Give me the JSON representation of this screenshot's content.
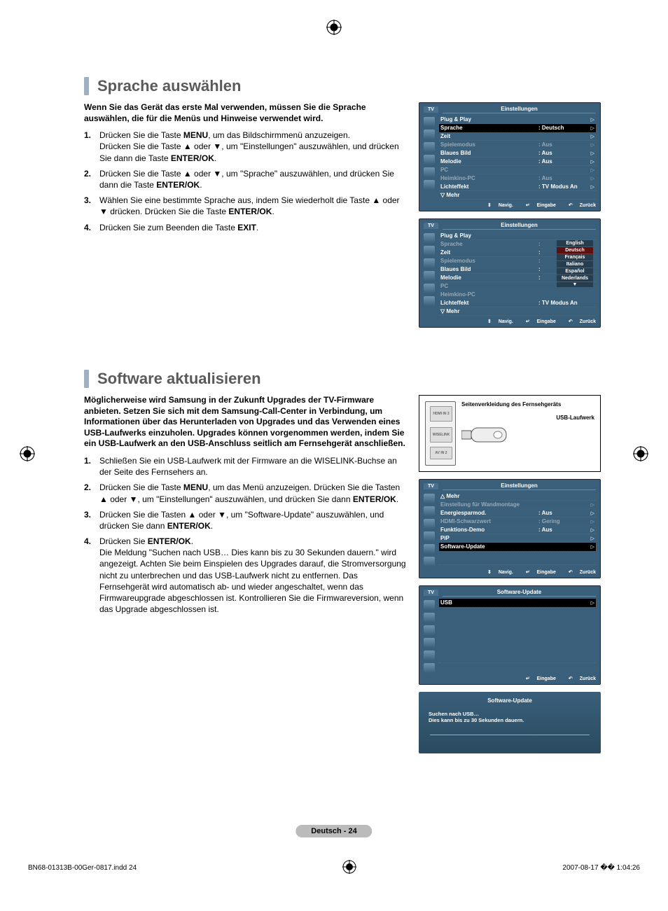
{
  "reg_glyph": "⊕",
  "section1": {
    "title": "Sprache auswählen",
    "intro": "Wenn Sie das Gerät das erste Mal verwenden, müssen Sie die Sprache auswählen, die für die Menüs und Hinweise verwendet wird.",
    "steps": [
      "Drücken Sie die Taste MENU, um das Bildschirmmenü anzuzeigen. Drücken Sie die Taste ▲ oder ▼, um \"Einstellungen\" auszuwählen, und drücken Sie dann die Taste ENTER/OK.",
      "Drücken Sie die Taste ▲ oder ▼, um \"Sprache\" auszuwählen, und drücken Sie dann die Taste ENTER/OK.",
      "Wählen Sie eine bestimmte Sprache aus, indem Sie wiederholt die Taste ▲ oder ▼ drücken. Drücken Sie die Taste ENTER/OK.",
      "Drücken Sie zum Beenden die Taste EXIT."
    ],
    "step1_a": "Drücken Sie die Taste ",
    "step1_menu": "MENU",
    "step1_b": ", um das Bildschirmmenü anzuzeigen.",
    "step1_c": "Drücken Sie die Taste ▲ oder ▼, um \"Einstellungen\" auszuwählen, und drücken Sie dann die Taste ",
    "step1_enter": "ENTER/OK",
    "step2_a": "Drücken Sie die Taste ▲ oder ▼, um \"Sprache\" auszuwählen, und drücken Sie dann die Taste ",
    "step3_a": "Wählen Sie eine bestimmte Sprache aus, indem Sie wiederholt die Taste ▲ oder ▼ drücken. Drücken Sie die Taste ",
    "step3_enter": "ENTER/OK",
    "step4_a": "Drücken Sie zum Beenden die Taste ",
    "step4_exit": "EXIT"
  },
  "osd1": {
    "tv": "TV",
    "title": "Einstellungen",
    "rows": {
      "plugplay": "Plug & Play",
      "sprache": "Sprache",
      "sprache_val": ": Deutsch",
      "zeit": "Zeit",
      "spiel": "Spielemodus",
      "spiel_val": ": Aus",
      "blau": "Blaues Bild",
      "blau_val": ": Aus",
      "melodie": "Melodie",
      "melodie_val": ": Aus",
      "pc": "PC",
      "heimkino": "Heimkino-PC",
      "heimkino_val": ": Aus",
      "licht": "Lichteffekt",
      "licht_val": ": TV Modus An",
      "mehr": "▽ Mehr"
    },
    "foot": {
      "navig": "Navig.",
      "eingabe": "Eingabe",
      "zurueck": "Zurück",
      "updown": "⇕",
      "enter": "↵",
      "back": "↶"
    }
  },
  "osd2_langs": [
    "English",
    "Deutsch",
    "Français",
    "Italiano",
    "Español",
    "Nederlands"
  ],
  "section2": {
    "title": "Software aktualisieren",
    "intro": "Möglicherweise wird Samsung in der Zukunft Upgrades der TV-Firmware anbieten. Setzen Sie sich mit dem Samsung-Call-Center in Verbindung, um Informationen über das Herunterladen von Upgrades und das Verwenden eines USB-Laufwerks einzuholen. Upgrades können vorgenommen werden, indem Sie ein USB-Laufwerk an den USB-Anschluss seitlich am Fernsehgerät anschließen.",
    "step1": "Schließen Sie ein USB-Laufwerk mit der Firmware an die WISELINK-Buchse an der Seite des Fernsehers an.",
    "step2_a": "Drücken Sie die Taste ",
    "step2_menu": "MENU",
    "step2_b": ", um das Menü anzuzeigen. Drücken Sie die Tasten ▲ oder ▼, um \"Einstellungen\" auszuwählen, und drücken Sie dann ",
    "step2_enter": "ENTER/OK",
    "step3_a": "Drücken Sie die Tasten ▲ oder ▼, um \"Software-Update\" auszuwählen, und drücken Sie dann ",
    "step4_a": "Drücken Sie ",
    "step4_b": "Die Meldung \"Suchen nach USB…  Dies kann bis zu 30 Sekunden dauern.\" wird angezeigt. Achten Sie beim Einspielen des Upgrades darauf, die Stromversorgung nicht zu unterbrechen und das USB-Laufwerk nicht zu entfernen. Das Fernsehgerät wird automatisch ab- und wieder angeschaltet, wenn das Firmwareupgrade abgeschlossen ist. Kontrollieren Sie die Firmwareversion, wenn das Upgrade abgeschlossen ist."
  },
  "diag": {
    "panel": "Seitenverkleidung des Fernsehgeräts",
    "usb": "USB-Laufwerk",
    "p1": "HDMI IN 3",
    "p2": "WISELINK",
    "p3": "AV IN 2"
  },
  "osd3": {
    "title": "Einstellungen",
    "mehr": "△ Mehr",
    "wand": "Einstellung für Wandmontage",
    "energie": "Energiesparmod.",
    "energie_val": ": Aus",
    "hdmi": "HDMI-Schwarzwert",
    "hdmi_val": ": Gering",
    "demo": "Funktions-Demo",
    "demo_val": ": Aus",
    "pip": "PIP",
    "sw": "Software-Update"
  },
  "osd4": {
    "title": "Software-Update",
    "usbrow": "USB"
  },
  "popup": {
    "title": "Software-Update",
    "l1": "Suchen nach USB…",
    "l2": "Dies kann bis zu 30 Sekunden dauern."
  },
  "pagefoot": "Deutsch - 24",
  "bleed": {
    "left": "BN68-01313B-00Ger-0817.indd   24",
    "right": "2007-08-17   �� 1:04:26"
  }
}
